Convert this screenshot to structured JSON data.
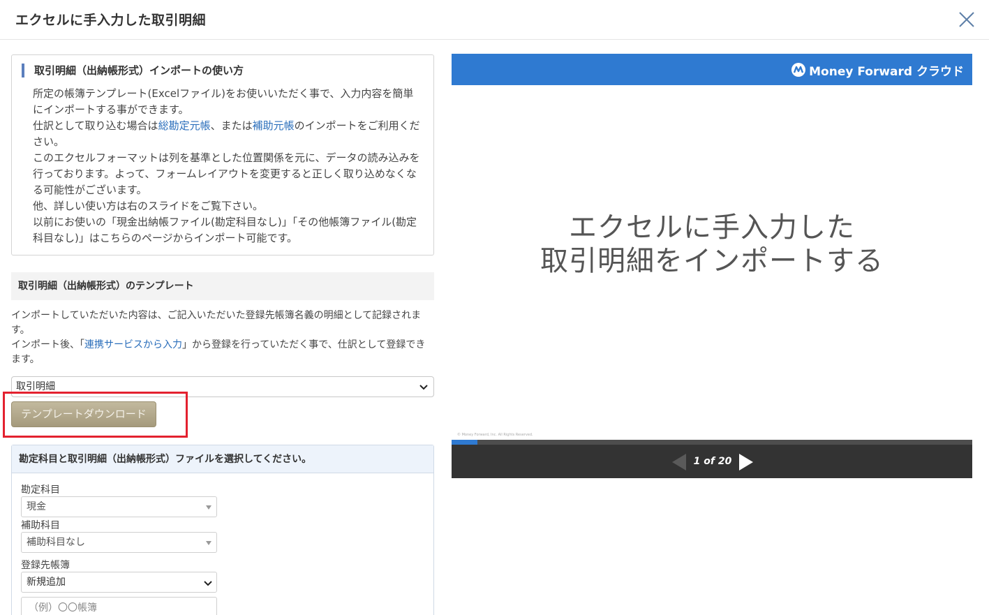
{
  "dialog": {
    "title": "エクセルに手入力した取引明細",
    "close_label": "×"
  },
  "usage": {
    "title": "取引明細（出納帳形式）インポートの使い方",
    "p1": "所定の帳簿テンプレート(Excelファイル)をお使いいただく事で、入力内容を簡単にインポートする事ができます。",
    "p2_before": "仕訳として取り込む場合は",
    "link_general_ledger": "総勘定元帳",
    "p2_middle": "、または",
    "link_sub_ledger": "補助元帳",
    "p2_after": "のインポートをご利用ください。",
    "p3": "このエクセルフォーマットは列を基準とした位置関係を元に、データの読み込みを行っております。よって、フォームレイアウトを変更すると正しく取り込めなくなる可能性がございます。",
    "p4": "他、詳しい使い方は右のスライドをご覧下さい。",
    "p5": "以前にお使いの「現金出納帳ファイル(勘定科目なし)」「その他帳簿ファイル(勘定科目なし)」はこちらのページからインポート可能です。"
  },
  "template_section": {
    "heading": "取引明細（出納帳形式）のテンプレート",
    "desc1": "インポートしていただいた内容は、ご記入いただいた登録先帳簿名義の明細として記録されます。",
    "desc2_before": "インポート後、「",
    "link_service": "連携サービスから入力",
    "desc2_after": "」から登録を行っていただく事で、仕訳として登録できます。",
    "select_value": "取引明細",
    "download_label": "テンプレートダウンロード"
  },
  "file_section": {
    "heading": "勘定科目と取引明細（出納帳形式）ファイルを選択してください。",
    "account_label": "勘定科目",
    "account_value": "現金",
    "sub_account_label": "補助科目",
    "sub_account_value": "補助科目なし",
    "ledger_label": "登録先帳簿",
    "ledger_value": "新規追加",
    "ledger_name_placeholder": "（例）〇〇帳簿"
  },
  "slides": {
    "brand": "Money Forward クラウド",
    "title_line1": "エクセルに手入力した",
    "title_line2": "取引明細をインポートする",
    "copyright": "© Money Forward, Inc. All Rights Reserved.",
    "counter": "1 of 20",
    "current": 1,
    "total": 20
  },
  "colors": {
    "brand_blue": "#2f7ad1",
    "highlight_red": "#e3212f",
    "link_blue": "#2a6ebb",
    "button_khaki": "#b3a98b"
  }
}
